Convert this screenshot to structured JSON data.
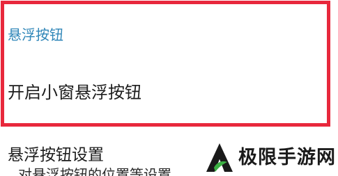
{
  "floating_section": {
    "header": "悬浮按钮",
    "toggle_row": {
      "title": "开启小窗悬浮按钮"
    }
  },
  "settings_item": {
    "title": "悬浮按钮设置",
    "subtitle": "对悬浮按钮的位置等设置"
  },
  "watermark": {
    "text": "极限手游网"
  },
  "colors": {
    "highlight_border": "#e8283c",
    "section_header": "#2f86b8",
    "logo_green": "#3cb043"
  }
}
